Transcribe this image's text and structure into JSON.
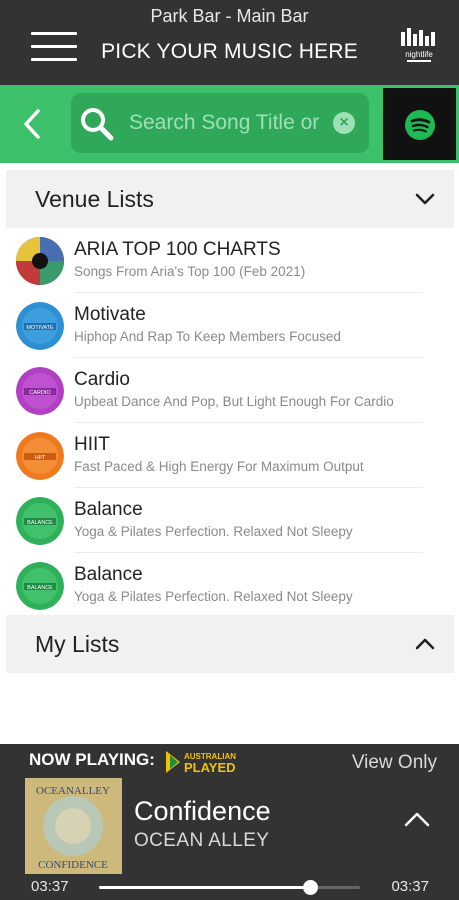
{
  "header": {
    "venue": "Park Bar - Main Bar",
    "title": "PICK YOUR MUSIC HERE",
    "logo_text": "nightlife"
  },
  "search": {
    "placeholder": "Search Song Title or Artist",
    "clear_icon": "×"
  },
  "venue_lists": {
    "label": "Venue Lists",
    "items": [
      {
        "name": "ARIA TOP 100 CHARTS",
        "desc": "Songs From Aria's Top 100 (Feb 2021)",
        "thumb_color": "#2b2b2b",
        "thumb_text": ""
      },
      {
        "name": "Motivate",
        "desc": "Hiphop And Rap To Keep Members Focused",
        "thumb_color": "#2f8fd3",
        "thumb_text": "MOTIVATE"
      },
      {
        "name": "Cardio",
        "desc": "Upbeat Dance And Pop, But Light Enough For Cardio",
        "thumb_color": "#b03fc4",
        "thumb_text": "CARDIO"
      },
      {
        "name": "HIIT",
        "desc": "Fast Paced & High Energy For Maximum Output",
        "thumb_color": "#ef7a1e",
        "thumb_text": "HIIT"
      },
      {
        "name": "Balance",
        "desc": "Yoga & Pilates Perfection. Relaxed Not Sleepy",
        "thumb_color": "#2fb15a",
        "thumb_text": "BALANCE"
      },
      {
        "name": "Balance",
        "desc": "Yoga & Pilates Perfection. Relaxed Not Sleepy",
        "thumb_color": "#2fb15a",
        "thumb_text": "BALANCE"
      }
    ]
  },
  "my_lists": {
    "label": "My Lists"
  },
  "player": {
    "now_playing_label": "NOW PLAYING:",
    "badge_top": "AUSTRALIAN",
    "badge_bottom": "PLAYED",
    "view_only": "View Only",
    "song": "Confidence",
    "artist": "OCEAN ALLEY",
    "album_top": "OCEANALLEY",
    "album_bottom": "CONFIDENCE",
    "elapsed": "03:37",
    "duration": "03:37",
    "progress": 0.81
  },
  "colors": {
    "accent": "#3cc06a",
    "header_bg": "#333333",
    "spotify": "#1db954"
  }
}
